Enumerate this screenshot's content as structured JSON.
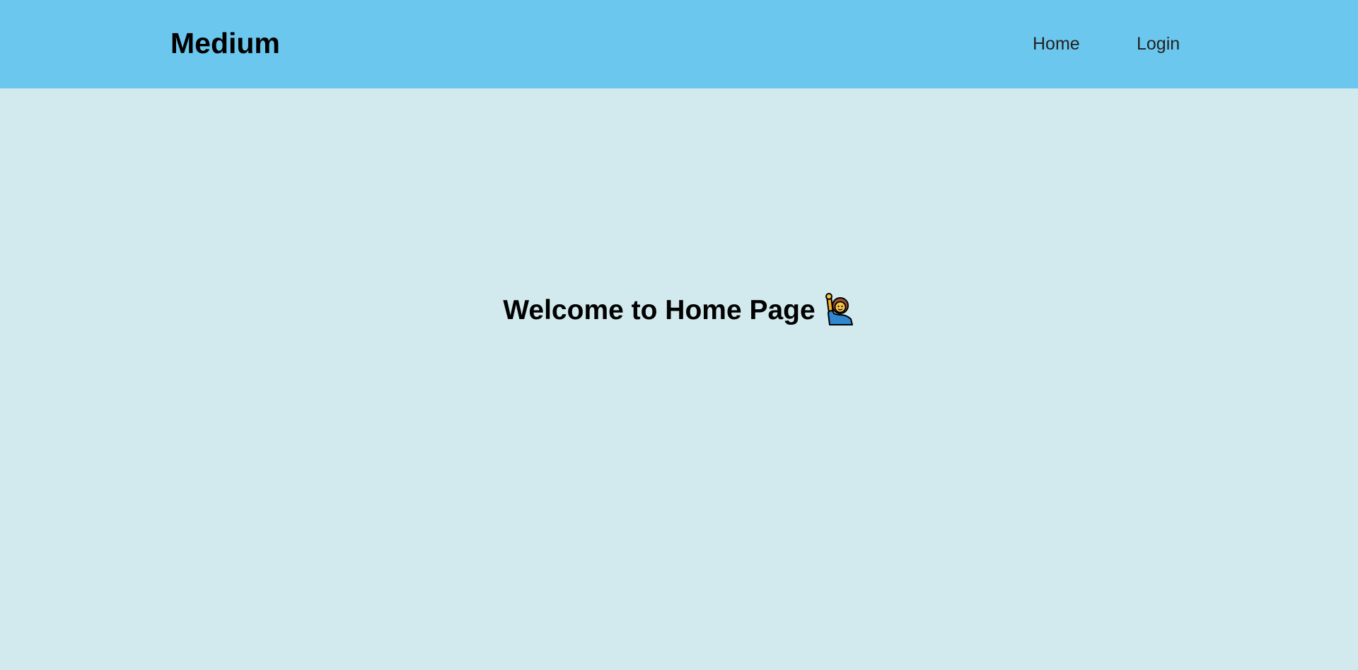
{
  "navbar": {
    "brand": "Medium",
    "links": [
      {
        "label": "Home"
      },
      {
        "label": "Login"
      }
    ],
    "background_color": "#6cc7ee"
  },
  "main": {
    "heading": "Welcome to Home Page",
    "heading_icon": "person-raising-hand-icon",
    "background_color": "#d2eaee"
  }
}
